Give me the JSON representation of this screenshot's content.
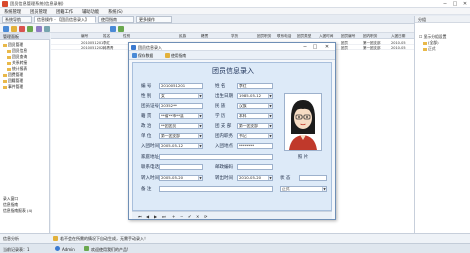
{
  "app": {
    "title": "团员信息管理系统(信息录制)",
    "window_controls": [
      "─",
      "□",
      "✕"
    ]
  },
  "menu": [
    "系统管理",
    "团员管理",
    "团籍工作",
    "辅助功能",
    "系统(S)"
  ],
  "tabs": [
    "系统导航",
    "信息操作 - 【团员信息录入】",
    "使用指南",
    "更多操作"
  ],
  "left_panel": {
    "header": "管理面板",
    "tree": [
      "团员管理",
      "团员信息",
      "团员查询",
      "关系转接",
      "统计报表",
      "团费管理",
      "团籍管理",
      "事件管理"
    ],
    "footer": [
      "录入窗口",
      "信息指南",
      "信息指南报表 (4)"
    ]
  },
  "grid": {
    "headers": [
      "编号",
      "姓名",
      "性别",
      "民族",
      "籍贯",
      "学历",
      "团员职务",
      "联系电话",
      "团员类型",
      "入团时间",
      "团员编号",
      "团内职务",
      "入团日期"
    ],
    "rows": [
      [
        "2010051201",
        "李红",
        "女",
        "汉族",
        "",
        "",
        "",
        "",
        "",
        "",
        "团员",
        "第一团支部",
        "2010-05"
      ],
      [
        "2010051202",
        "韩青青",
        "女",
        "汉族",
        "",
        "",
        "",
        "",
        "",
        "",
        "团员",
        "第一团支部",
        "2010-05"
      ]
    ]
  },
  "right_panel": {
    "header": "分组",
    "items": [
      "显示分组设置",
      "(全部)",
      "正式"
    ]
  },
  "dialog": {
    "title": "团员信息录入",
    "toolbar": [
      "保存数据",
      "使用指南"
    ],
    "form_title": "团员信息录入",
    "fields": {
      "id": {
        "label": "编 号",
        "value": "2010051201"
      },
      "name": {
        "label": "姓 名",
        "value": "李红"
      },
      "gender": {
        "label": "性 别",
        "value": "女"
      },
      "birthdate": {
        "label": "出生日期",
        "value": "1985-05-12"
      },
      "member_no": {
        "label": "团员证号",
        "value": "20352**"
      },
      "ethnicity": {
        "label": "民 族",
        "value": "汉族"
      },
      "hometown": {
        "label": "籍 贯",
        "value": "**省**市**县"
      },
      "education": {
        "label": "学 历",
        "value": "本科"
      },
      "appearance": {
        "label": "政 治",
        "value": "**团团员"
      },
      "branch": {
        "label": "团 支 部",
        "value": "第一团支部"
      },
      "unit": {
        "label": "单 位",
        "value": "第一团支部"
      },
      "position": {
        "label": "团内职务",
        "value": "书记"
      },
      "join_date": {
        "label": "入团时间",
        "value": "2005-05-12"
      },
      "join_place": {
        "label": "入团地点",
        "value": "********"
      },
      "address": {
        "label": "家庭地址",
        "value": ""
      },
      "phone": {
        "label": "联系电话",
        "value": ""
      },
      "postcode": {
        "label": "邮政编码",
        "value": ""
      },
      "transfer_in": {
        "label": "转入时间",
        "value": "2005-05-20"
      },
      "transfer_out": {
        "label": "转出时间",
        "value": "2010-05-20"
      },
      "status": {
        "label": "状 态",
        "value": ""
      },
      "remark": {
        "label": "备 注",
        "value": ""
      },
      "member_type": {
        "label": "",
        "value": "正式"
      }
    },
    "photo_label": "照 片",
    "nav": [
      "⏮",
      "◀",
      "▶",
      "⏭",
      "+",
      "−",
      "✔",
      "✕",
      "⟳"
    ]
  },
  "statusbar": {
    "message": "若不会在所需的情况下自动生成，无需手动录入！",
    "left_label": "信息分析"
  },
  "bottombar": {
    "left": "当前记录表：1",
    "user": "Admin",
    "welcome": "欢迎使用我们的产品!"
  },
  "colors": {
    "form_bg": "#ddeaf8",
    "dialog_border": "#6f8fb6",
    "accent": "#3b7ad0"
  }
}
